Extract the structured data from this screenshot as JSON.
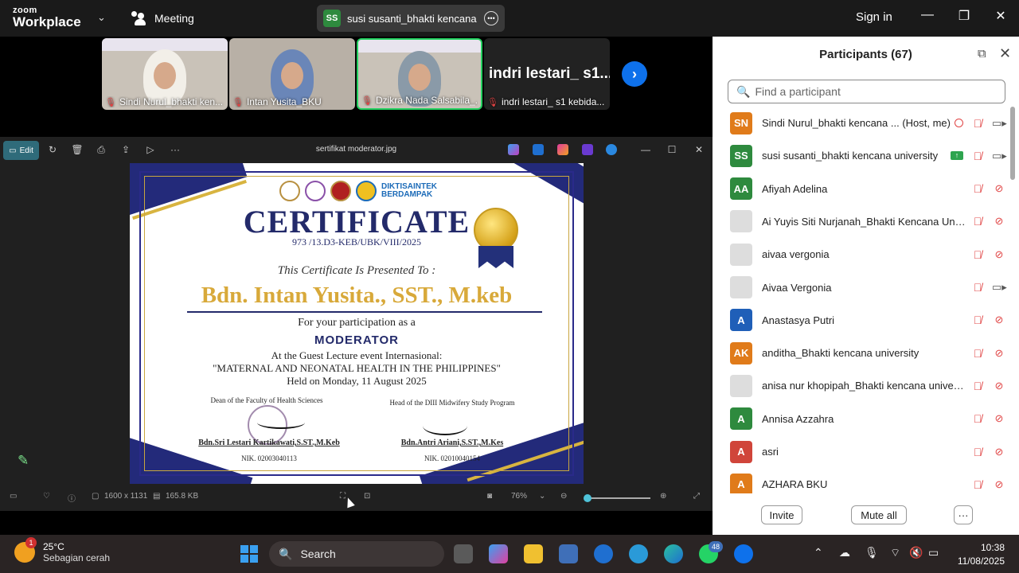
{
  "topbar": {
    "brand_line1": "zoom",
    "brand_line2": "Workplace",
    "meeting_label": "Meeting",
    "active_speaker": {
      "initials": "SS",
      "name": "susi susanti_bhakti kencana univc"
    },
    "sign_in": "Sign in"
  },
  "video_tiles": [
    {
      "name": "Sindi Nurul_bhakti ken...",
      "muted": true,
      "active": false
    },
    {
      "name": "Intan Yusita_BKU",
      "muted": true,
      "active": false
    },
    {
      "name": "Dzikra Nada Salsabila_...",
      "muted": true,
      "active": true
    },
    {
      "name": "indri lestari_ s1 kebida...",
      "big_name": "indri lestari_ s1...",
      "muted": true,
      "active": false
    }
  ],
  "viewer": {
    "edit_label": "Edit",
    "file_title": "sertifikat moderator.jpg",
    "dimensions": "1600 x 1131",
    "file_size": "165.8 KB",
    "zoom_level": "76%"
  },
  "certificate": {
    "logo_text_line1": "DIKTISAINTEK",
    "logo_text_line2": "BERDAMPAK",
    "title": "CERTIFICATE",
    "number": "973 /13.D3-KEB/UBK/VIII/2025",
    "presented_to": "This Certificate Is Presented To :",
    "recipient": "Bdn. Intan Yusita., SST., M.keb",
    "participation": "For your participation as a",
    "role": "MODERATOR",
    "event_line": "At the Guest Lecture event Internasional:",
    "event_name": "\"MATERNAL AND NEONATAL HEALTH IN THE PHILIPPINES\"",
    "held_on": "Held on Monday, 11 August 2025",
    "sig1_title": "Dean of the Faculty of Health Sciences",
    "sig1_name": "Bdn.Sri Lestari Kartikawati,S.ST.,M.Keb",
    "sig1_nik": "NIK. 02003040113",
    "sig2_title": "Head of the DIII Midwifery Study Program",
    "sig2_name": "Bdn.Antri Ariani,S.ST.,M.Kes",
    "sig2_nik": "NIK. 02010040154"
  },
  "participants": {
    "title": "Participants (67)",
    "search_placeholder": "Find a participant",
    "list": [
      {
        "initials": "SN",
        "color": "#e07b1a",
        "name": "Sindi Nurul_bhakti kencana ... (Host, me)",
        "host": true,
        "cam_on": true
      },
      {
        "initials": "SS",
        "color": "#2e8a3e",
        "name": "susi susanti_bhakti kencana university",
        "share": true,
        "cam_on": true
      },
      {
        "initials": "AA",
        "color": "#2e8a3e",
        "name": "Afiyah Adelina",
        "cam_on": false
      },
      {
        "initials": "",
        "color": "#ddd",
        "photo": true,
        "name": "Ai Yuyis Siti Nurjanah_Bhakti Kencana Univ...",
        "cam_on": false
      },
      {
        "initials": "",
        "color": "#ddd",
        "photo": true,
        "name": "aivaa vergonia",
        "cam_on": false
      },
      {
        "initials": "",
        "color": "#ddd",
        "photo": true,
        "name": "Aivaa Vergonia",
        "cam_on": true
      },
      {
        "initials": "A",
        "color": "#1f5fb8",
        "name": "Anastasya Putri",
        "cam_on": false
      },
      {
        "initials": "AK",
        "color": "#e07b1a",
        "name": "anditha_Bhakti kencana university",
        "cam_on": false
      },
      {
        "initials": "",
        "color": "#ddd",
        "photo": true,
        "name": "anisa nur khopipah_Bhakti kencana univers...",
        "cam_on": false
      },
      {
        "initials": "A",
        "color": "#2e8a3e",
        "name": "Annisa Azzahra",
        "cam_on": false
      },
      {
        "initials": "A",
        "color": "#d0453a",
        "name": "asri",
        "cam_on": false
      },
      {
        "initials": "A",
        "color": "#e07b1a",
        "name": "AZHARA BKU",
        "cam_on": false
      }
    ],
    "invite_label": "Invite",
    "mute_all_label": "Mute all",
    "more_label": "···"
  },
  "taskbar": {
    "weather_badge": "1",
    "temperature": "25°C",
    "weather_desc": "Sebagian cerah",
    "search_label": "Search",
    "whatsapp_badge": "48",
    "time": "10:38",
    "date": "11/08/2025"
  }
}
